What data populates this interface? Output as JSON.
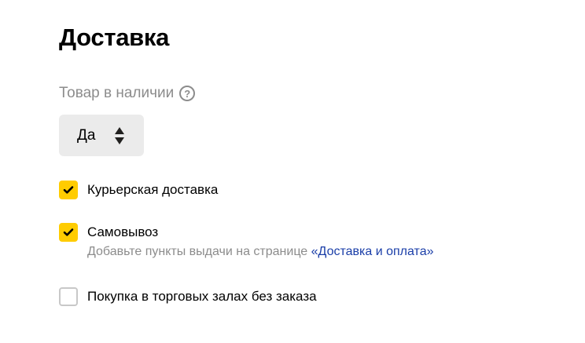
{
  "page": {
    "title": "Доставка"
  },
  "availability": {
    "label": "Товар в наличии",
    "help_icon": "question-circle-icon",
    "select_value": "Да",
    "select_icon": "sort-arrows-icon"
  },
  "delivery_options": {
    "courier": {
      "label": "Курьерская доставка",
      "checked": true
    },
    "pickup": {
      "label": "Самовывоз",
      "checked": true,
      "hint_text": "Добавьте пункты выдачи на странице ",
      "hint_link": "«Доставка и оплата»"
    },
    "in_store": {
      "label": "Покупка в торговых залах без заказа",
      "checked": false
    }
  },
  "colors": {
    "accent": "#ffcc00",
    "link": "#1a3ea8",
    "muted_text": "#8c8c8c",
    "select_bg": "#ebebeb"
  }
}
